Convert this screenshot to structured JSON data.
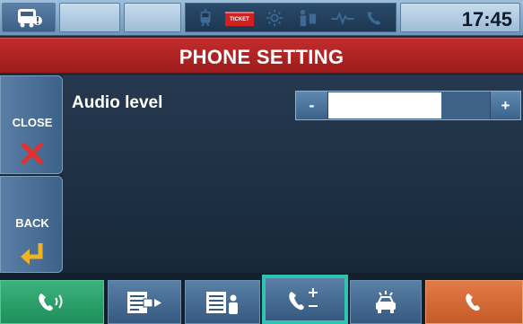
{
  "status_bar": {
    "time": "17:45",
    "ticket_label": "TICKET"
  },
  "title": "PHONE SETTING",
  "side_buttons": {
    "close_label": "CLOSE",
    "back_label": "BACK"
  },
  "audio": {
    "label": "Audio level",
    "minus_label": "-",
    "plus_label": "+",
    "level": 0.7
  },
  "bottom_bar": {
    "selected": "add-call-button"
  },
  "colors": {
    "title_red": "#b22222",
    "call_green": "#2aa36b",
    "hangup_orange": "#d8683a",
    "selected_teal": "#2ec4b0"
  },
  "icons": {
    "vehicle": "vehicle-alert-icon",
    "tram": "tram-icon",
    "ticket": "ticket-icon",
    "light": "light-icon",
    "person": "passenger-icon",
    "signal": "signal-icon",
    "phone": "phone-icon",
    "close": "close-x-icon",
    "back": "back-arrow-icon",
    "call_volume": "phone-volume-icon",
    "send_message": "send-message-icon",
    "message_passenger": "message-passenger-icon",
    "add_call": "add-call-icon",
    "taxi": "taxi-icon",
    "hangup": "hangup-icon"
  }
}
